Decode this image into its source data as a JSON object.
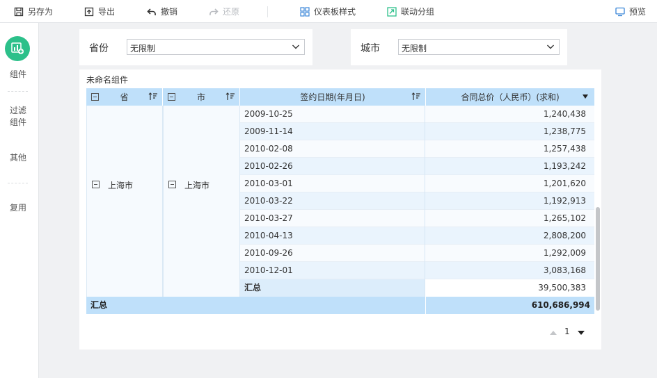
{
  "toolbar": {
    "save_as": "另存为",
    "export": "导出",
    "undo": "撤销",
    "redo": "还原",
    "dashboard_style": "仪表板样式",
    "linkage_group": "联动分组",
    "preview": "预览"
  },
  "sidebar": {
    "items": [
      {
        "label": "组件"
      },
      {
        "label": "过滤\n组件"
      },
      {
        "label": "其他"
      },
      {
        "label": "复用"
      }
    ]
  },
  "filters": [
    {
      "label": "省份",
      "value": "无限制"
    },
    {
      "label": "城市",
      "value": "无限制"
    }
  ],
  "widget": {
    "title": "未命名组件",
    "columns": [
      "省",
      "市",
      "签约日期(年月日)",
      "合同总价（人民币）(求和)"
    ],
    "province": "上海市",
    "city": "上海市",
    "rows": [
      {
        "date": "2009-10-25",
        "value": "1,240,438"
      },
      {
        "date": "2009-11-14",
        "value": "1,238,775"
      },
      {
        "date": "2010-02-08",
        "value": "1,257,438"
      },
      {
        "date": "2010-02-26",
        "value": "1,193,242"
      },
      {
        "date": "2010-03-01",
        "value": "1,201,620"
      },
      {
        "date": "2010-03-22",
        "value": "1,192,913"
      },
      {
        "date": "2010-03-27",
        "value": "1,265,102"
      },
      {
        "date": "2010-04-13",
        "value": "2,808,200"
      },
      {
        "date": "2010-09-26",
        "value": "1,292,009"
      },
      {
        "date": "2010-12-01",
        "value": "3,083,168"
      }
    ],
    "subtotal_label": "汇总",
    "subtotal_value": "39,500,383",
    "total_label": "汇总",
    "total_value": "610,686,994"
  },
  "pager": {
    "page": "1"
  },
  "colors": {
    "accent": "#2cc08a",
    "header_bg": "#bfe0fa",
    "row_alt": "#eaf4fd"
  }
}
